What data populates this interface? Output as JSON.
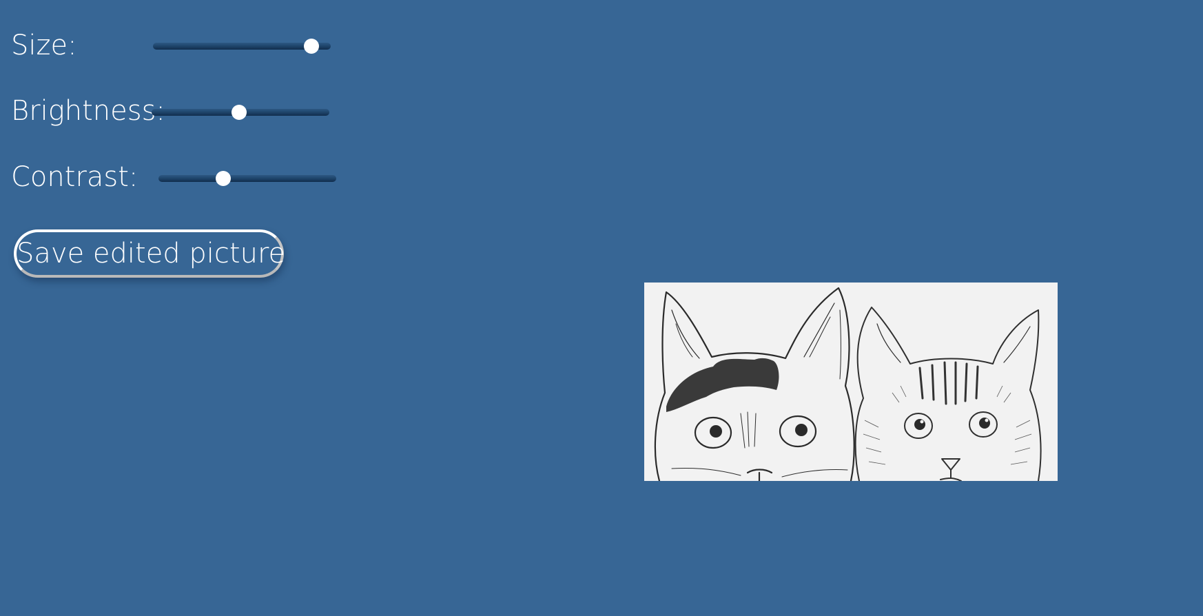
{
  "controls": {
    "size": {
      "label": "Size:",
      "value": 0.93
    },
    "brightness": {
      "label": "Brightness:",
      "value": 0.49
    },
    "contrast": {
      "label": "Contrast:",
      "value": 0.35
    }
  },
  "save_button": {
    "label": "Save edited picture"
  },
  "image": {
    "description_icon": "two-cats-sketch"
  },
  "colors": {
    "background": "#376695",
    "track_dark": "#102c4a",
    "text": "#ffffff"
  }
}
